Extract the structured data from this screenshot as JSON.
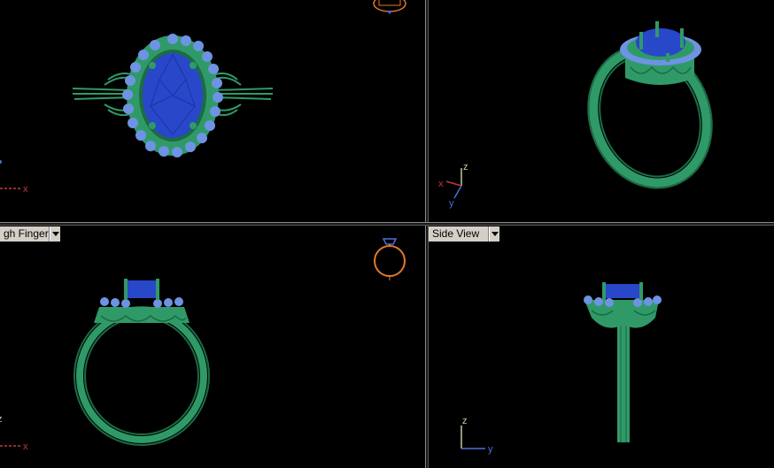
{
  "viewports": {
    "top": {
      "axis_x": "x"
    },
    "perspective": {
      "axis_x": "x",
      "axis_y": "y",
      "axis_z": "z"
    },
    "front": {
      "label": "gh Finger",
      "axis_x": "x",
      "axis_z": "z"
    },
    "side": {
      "label": "Side View",
      "axis_y": "y",
      "axis_z": "z"
    }
  },
  "colors": {
    "metal": "#2f9a68",
    "metal_dark": "#1d6b44",
    "stone": "#2847c9",
    "halo": "#6d93e2",
    "axis_x": "#c23a3a",
    "axis_y": "#4a6fd8",
    "axis_z": "#c9c9a0",
    "gizmo": "#e07a2a"
  },
  "icons": [
    "ring-gizmo-icon",
    "view-dropdown-icon"
  ]
}
